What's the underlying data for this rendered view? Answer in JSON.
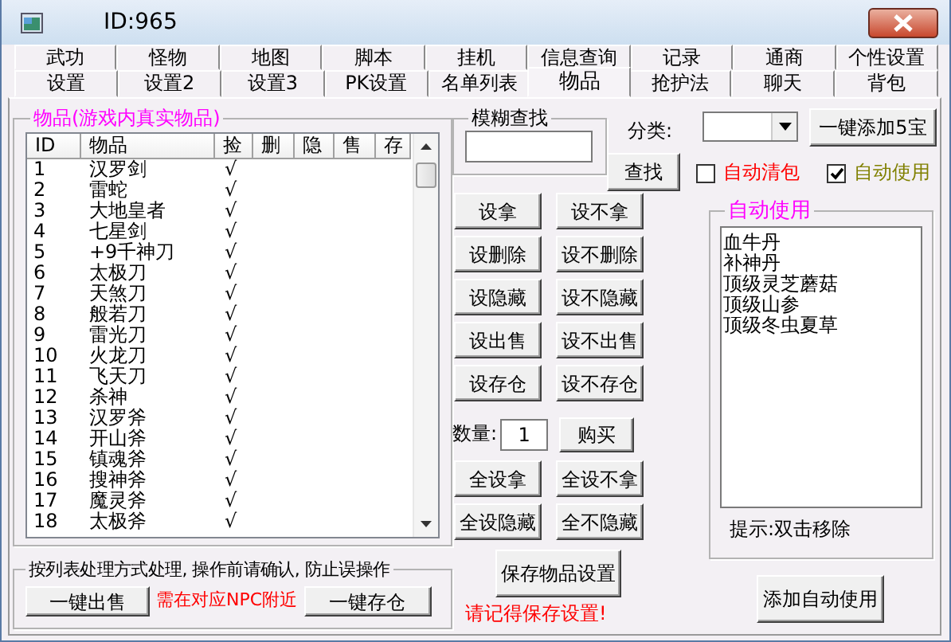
{
  "window": {
    "title": "ID:965"
  },
  "tab_rows": [
    {
      "tabs": [
        {
          "label": "武功",
          "selected": false
        },
        {
          "label": "怪物",
          "selected": false
        },
        {
          "label": "地图",
          "selected": false
        },
        {
          "label": "脚本",
          "selected": false
        },
        {
          "label": "挂机",
          "selected": false
        },
        {
          "label": "信息查询",
          "selected": false
        },
        {
          "label": "记录",
          "selected": false
        },
        {
          "label": "通商",
          "selected": false
        },
        {
          "label": "个性设置",
          "selected": false
        }
      ]
    },
    {
      "tabs": [
        {
          "label": "设置",
          "selected": false
        },
        {
          "label": "设置2",
          "selected": false
        },
        {
          "label": "设置3",
          "selected": false
        },
        {
          "label": "PK设置",
          "selected": false
        },
        {
          "label": "名单列表",
          "selected": false
        },
        {
          "label": "物品",
          "selected": true
        },
        {
          "label": "抢护法",
          "selected": false
        },
        {
          "label": "聊天",
          "selected": false
        },
        {
          "label": "背包",
          "selected": false
        }
      ]
    }
  ],
  "items_group": {
    "legend": "物品(游戏内真实物品)",
    "columns": [
      "ID",
      "物品",
      "捡",
      "删",
      "隐",
      "售",
      "存"
    ],
    "rows": [
      {
        "id": "1",
        "name": "汉罗剑",
        "pick": "√"
      },
      {
        "id": "2",
        "name": "雷蛇",
        "pick": "√"
      },
      {
        "id": "3",
        "name": "大地皇者",
        "pick": "√"
      },
      {
        "id": "4",
        "name": "七星剑",
        "pick": "√"
      },
      {
        "id": "5",
        "name": "+9千神刀",
        "pick": "√"
      },
      {
        "id": "6",
        "name": "太极刀",
        "pick": "√"
      },
      {
        "id": "7",
        "name": "天煞刀",
        "pick": "√"
      },
      {
        "id": "8",
        "name": "般若刀",
        "pick": "√"
      },
      {
        "id": "9",
        "name": "雷光刀",
        "pick": "√"
      },
      {
        "id": "10",
        "name": "火龙刀",
        "pick": "√"
      },
      {
        "id": "11",
        "name": "飞天刀",
        "pick": "√"
      },
      {
        "id": "12",
        "name": "杀神",
        "pick": "√"
      },
      {
        "id": "13",
        "name": "汉罗斧",
        "pick": "√"
      },
      {
        "id": "14",
        "name": "开山斧",
        "pick": "√"
      },
      {
        "id": "15",
        "name": "镇魂斧",
        "pick": "√"
      },
      {
        "id": "16",
        "name": "搜神斧",
        "pick": "√"
      },
      {
        "id": "17",
        "name": "魔灵斧",
        "pick": "√"
      },
      {
        "id": "18",
        "name": "太极斧",
        "pick": "√"
      }
    ]
  },
  "batch": {
    "legend": "按列表处理方式处理, 操作前请确认, 防止误操作",
    "sell_button": "一键出售",
    "note": "需在对应NPC附近",
    "store_button": "一键存仓"
  },
  "search": {
    "legend": "模糊查找",
    "button": "查找"
  },
  "category": {
    "label": "分类:"
  },
  "add_button": "一键添加5宝",
  "checkboxes": [
    {
      "label": "自动清包",
      "checked": false,
      "color": "#ff0000"
    },
    {
      "label": "自动使用",
      "checked": true,
      "color": "#808000"
    }
  ],
  "action_rows": [
    {
      "buttons": [
        "设拿",
        "设不拿"
      ]
    },
    {
      "buttons": [
        "设删除",
        "设不删除"
      ]
    },
    {
      "buttons": [
        "设隐藏",
        "设不隐藏"
      ]
    },
    {
      "buttons": [
        "设出售",
        "设不出售"
      ]
    },
    {
      "buttons": [
        "设存仓",
        "设不存仓"
      ]
    }
  ],
  "quantity": {
    "label": "数量:",
    "value": "1",
    "button": "购买"
  },
  "bulk_rows": [
    {
      "buttons": [
        "全设拿",
        "全设不拿"
      ]
    },
    {
      "buttons": [
        "全设隐藏",
        "全不隐藏"
      ]
    }
  ],
  "save_button": "保存物品设置",
  "save_note": "请记得保存设置!",
  "auto_use": {
    "legend": "自动使用",
    "items": [
      "血牛丹",
      "补神丹",
      "顶级灵芝蘑菇",
      "顶级山参",
      "顶级冬虫夏草"
    ],
    "hint": "提示:双击移除",
    "button": "添加自动使用"
  }
}
